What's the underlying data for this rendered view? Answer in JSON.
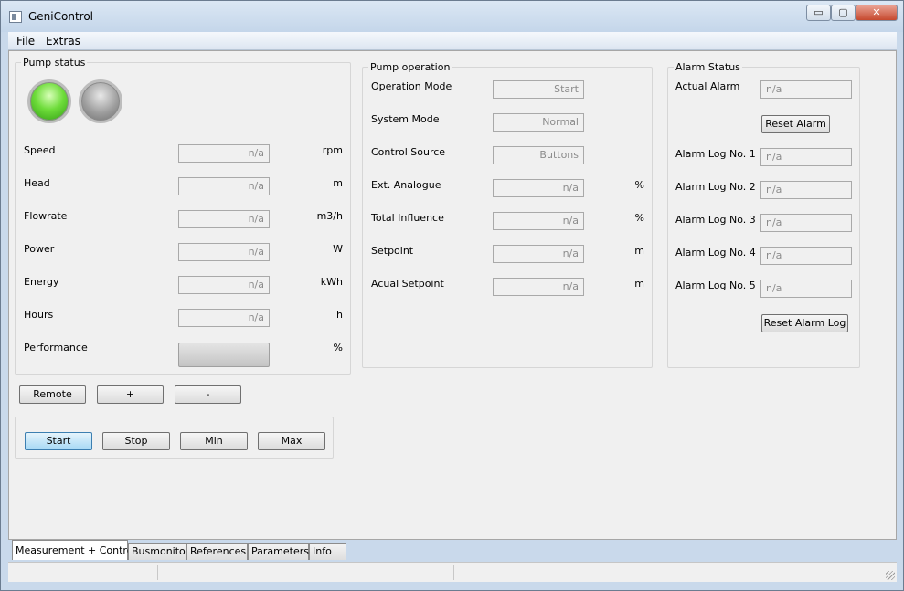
{
  "window": {
    "title": "GeniControl",
    "controls": {
      "minimize": "▭",
      "maximize": "▢",
      "close": "✕"
    }
  },
  "menu": [
    "File",
    "Extras"
  ],
  "pump_status": {
    "title": "Pump status",
    "leds": [
      {
        "state": "on",
        "color": "#55c92a"
      },
      {
        "state": "off",
        "color": "#8a8a8a"
      }
    ],
    "rows": [
      {
        "label": "Speed",
        "value": "n/a",
        "unit": "rpm"
      },
      {
        "label": "Head",
        "value": "n/a",
        "unit": "m"
      },
      {
        "label": "Flowrate",
        "value": "n/a",
        "unit": "m3/h"
      },
      {
        "label": "Power",
        "value": "n/a",
        "unit": "W"
      },
      {
        "label": "Energy",
        "value": "n/a",
        "unit": "kWh"
      },
      {
        "label": "Hours",
        "value": "n/a",
        "unit": "h"
      }
    ],
    "performance": {
      "label": "Performance",
      "unit": "%",
      "progress": 0
    }
  },
  "control_buttons": {
    "remote": "Remote",
    "plus": "+",
    "minus": "-"
  },
  "mode_buttons": {
    "start": "Start",
    "stop": "Stop",
    "min": "Min",
    "max": "Max",
    "active": "start"
  },
  "pump_operation": {
    "title": "Pump operation",
    "rows": [
      {
        "label": "Operation Mode",
        "value": "Start",
        "unit": ""
      },
      {
        "label": "System Mode",
        "value": "Normal",
        "unit": ""
      },
      {
        "label": "Control Source",
        "value": "Buttons",
        "unit": ""
      },
      {
        "label": "Ext. Analogue",
        "value": "n/a",
        "unit": "%"
      },
      {
        "label": "Total Influence",
        "value": "n/a",
        "unit": "%"
      },
      {
        "label": "Setpoint",
        "value": "n/a",
        "unit": "m"
      },
      {
        "label": "Acual Setpoint",
        "value": "n/a",
        "unit": "m"
      }
    ]
  },
  "alarm_status": {
    "title": "Alarm Status",
    "actual": {
      "label": "Actual Alarm",
      "value": "n/a"
    },
    "reset_alarm": "Reset Alarm",
    "logs": [
      {
        "label": "Alarm Log No. 1",
        "value": "n/a"
      },
      {
        "label": "Alarm Log No. 2",
        "value": "n/a"
      },
      {
        "label": "Alarm Log No. 3",
        "value": "n/a"
      },
      {
        "label": "Alarm Log No. 4",
        "value": "n/a"
      },
      {
        "label": "Alarm Log No. 5",
        "value": "n/a"
      }
    ],
    "reset_log": "Reset Alarm Log"
  },
  "tabs": [
    "Measurement + Control",
    "Busmonitor",
    "References",
    "Parameters",
    "Info"
  ],
  "selected_tab": 0
}
